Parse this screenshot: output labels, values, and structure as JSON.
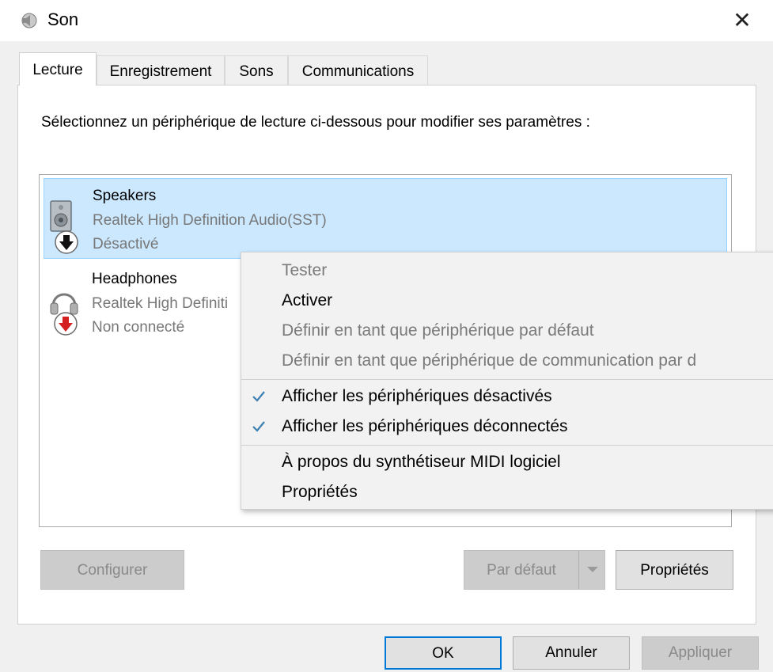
{
  "window": {
    "title": "Son",
    "close_glyph": "✕"
  },
  "tabs": [
    {
      "label": "Lecture",
      "active": true
    },
    {
      "label": "Enregistrement",
      "active": false
    },
    {
      "label": "Sons",
      "active": false
    },
    {
      "label": "Communications",
      "active": false
    }
  ],
  "instructions": "Sélectionnez un périphérique de lecture ci-dessous pour modifier ses paramètres :",
  "devices": [
    {
      "name": "Speakers",
      "description": "Realtek High Definition Audio(SST)",
      "status": "Désactivé",
      "icon": "speaker-icon",
      "badge": "disabled-arrow-icon",
      "selected": true
    },
    {
      "name": "Headphones",
      "description": "Realtek High Definiti",
      "status": "Non connecté",
      "icon": "headphones-icon",
      "badge": "disconnected-arrow-icon",
      "selected": false
    }
  ],
  "context_menu": {
    "items": [
      {
        "label": "Tester",
        "enabled": false,
        "checked": false
      },
      {
        "label": "Activer",
        "enabled": true,
        "checked": false
      },
      {
        "label": "Définir en tant que périphérique par défaut",
        "enabled": false,
        "checked": false
      },
      {
        "label": "Définir en tant que périphérique de communication par d",
        "enabled": false,
        "checked": false
      },
      {
        "label": "Afficher les périphériques désactivés",
        "enabled": true,
        "checked": true
      },
      {
        "label": "Afficher les périphériques déconnectés",
        "enabled": true,
        "checked": true
      },
      {
        "label": "À propos du synthétiseur MIDI logiciel",
        "enabled": true,
        "checked": false
      },
      {
        "label": "Propriétés",
        "enabled": true,
        "checked": false
      }
    ]
  },
  "buttons": {
    "configure": "Configurer",
    "set_default": "Par défaut",
    "properties": "Propriétés",
    "ok": "OK",
    "cancel": "Annuler",
    "apply": "Appliquer"
  },
  "colors": {
    "selection_bg": "#cce8ff",
    "selection_border": "#99d1ff",
    "check_color": "#3c7fb1",
    "disconnected_badge": "#d42020",
    "default_button_border": "#0078d7"
  }
}
